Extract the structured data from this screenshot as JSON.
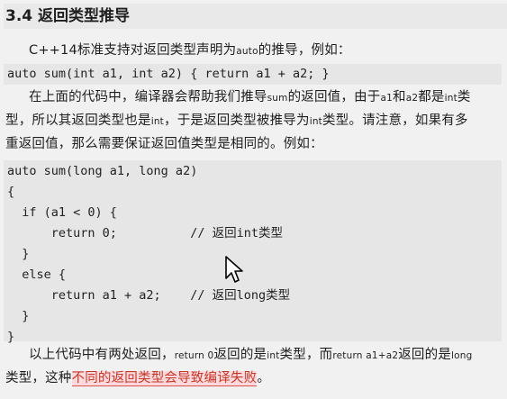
{
  "title": "3.4 返回类型推导",
  "para1": {
    "pre": "C++14标准支持对返回类型声明为",
    "kw": "auto",
    "post": "的推导，例如："
  },
  "code1": "auto sum(int a1, int a2) { return a1 + a2; }",
  "para2": {
    "line1_a": "在上面的代码中，编译器会帮助我们推导",
    "line1_sum": "sum",
    "line1_b": "的返回值，由于",
    "line1_a1": "a1",
    "line1_c": "和",
    "line1_a2": "a2",
    "line1_d": "都是",
    "line1_int": "int",
    "line1_e": "类",
    "line2_a": "型，所以其返回类型也是",
    "line2_int": "int",
    "line2_b": "，于是返回类型被推导为",
    "line2_int2": "int",
    "line2_c": "类型。请注意，如果有多",
    "line3": "重返回值，那么需要保证返回值类型是相同的。例如："
  },
  "code2": [
    "auto sum(long a1, long a2)",
    "{",
    "  if (a1 < 0) {",
    "      return 0;          // 返回int类型",
    "  }",
    "  else {",
    "      return a1 + a2;    // 返回long类型",
    "  }",
    "}"
  ],
  "para3": {
    "line1_a": "以上代码中有两处返回，",
    "line1_r0": "return 0",
    "line1_b": "返回的是",
    "line1_int": "int",
    "line1_c": "类型，而",
    "line1_r1": "return a1+a2",
    "line1_d": "返回的是",
    "line1_long": "long",
    "line2_a": "类型，这种",
    "line2_hl": "不同的返回类型会导致编译失败",
    "line2_b": "。"
  },
  "colors": {
    "page_bg": "#f1f1f1",
    "code_bg": "#e6e6e6",
    "highlight_text": "#c0392b",
    "highlight_bg": "#ffd9dc"
  },
  "icons": {
    "cursor": "mouse-pointer-icon"
  }
}
